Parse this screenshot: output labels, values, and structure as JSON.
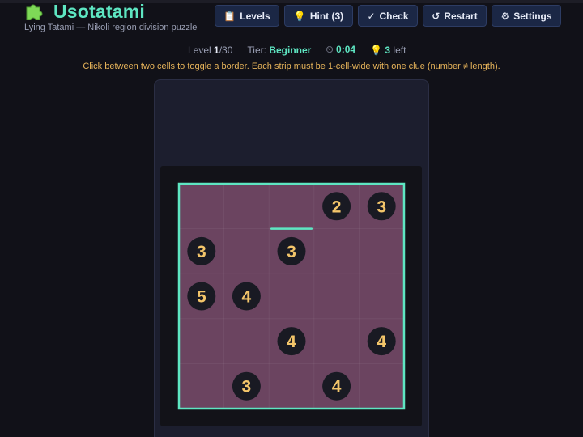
{
  "app": {
    "title": "Usotatami",
    "subtitle": "Lying Tatami — Nikoli region division puzzle",
    "icon": "puzzle-piece-icon"
  },
  "toolbar": {
    "levels": {
      "icon": "📋",
      "label": "Levels"
    },
    "hint": {
      "icon": "💡",
      "label": "Hint (3)"
    },
    "check": {
      "icon": "✓",
      "label": "Check"
    },
    "restart": {
      "icon": "↺",
      "label": "Restart"
    },
    "settings": {
      "icon": "⚙",
      "label": "Settings"
    }
  },
  "status": {
    "level_label": "Level",
    "level_current": "1",
    "level_total": "/30",
    "tier_label": "Tier:",
    "tier_value": "Beginner",
    "timer_icon": "⏲",
    "timer": "0:04",
    "hints_icon": "💡",
    "hints_count": "3",
    "hints_suffix": "left"
  },
  "instructions": "Click between two cells to toggle a border. Each strip must be 1-cell-wide with one clue (number ≠ length).",
  "colors": {
    "accent": "#5ee6c2",
    "board_fill": "#6b4460",
    "clue_circle": "#191a23",
    "clue_text": "#f3c56a",
    "warning_text": "#e7b45a"
  },
  "grid": {
    "rows": 5,
    "cols": 5,
    "clues": [
      {
        "row": 0,
        "col": 3,
        "value": "2"
      },
      {
        "row": 0,
        "col": 4,
        "value": "3"
      },
      {
        "row": 1,
        "col": 0,
        "value": "3"
      },
      {
        "row": 1,
        "col": 2,
        "value": "3"
      },
      {
        "row": 2,
        "col": 0,
        "value": "5"
      },
      {
        "row": 2,
        "col": 1,
        "value": "4"
      },
      {
        "row": 3,
        "col": 2,
        "value": "4"
      },
      {
        "row": 3,
        "col": 4,
        "value": "4"
      },
      {
        "row": 4,
        "col": 1,
        "value": "3"
      },
      {
        "row": 4,
        "col": 3,
        "value": "4"
      }
    ],
    "user_borders": [
      {
        "orientation": "horizontal",
        "between_rows": [
          0,
          1
        ],
        "col": 2
      }
    ]
  }
}
